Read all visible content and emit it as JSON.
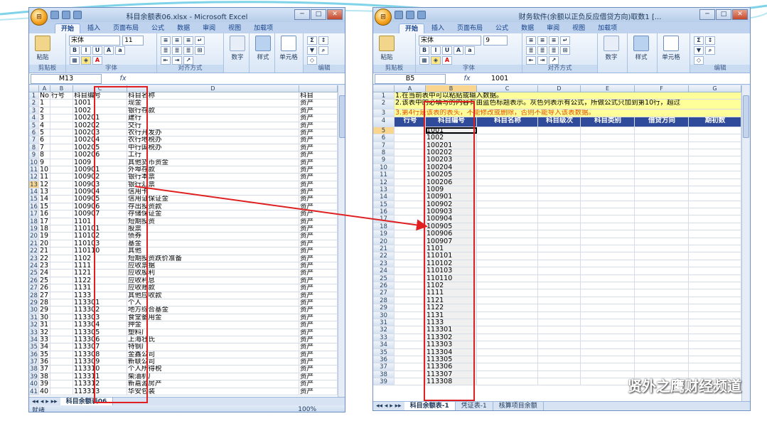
{
  "colors": {
    "accent": "#e02020",
    "header_blue": "#2f4b9a",
    "note_yellow": "#ffff99",
    "selection": "#f9d58e"
  },
  "left": {
    "title": "科目余额表06.xlsx - Microsoft Excel",
    "tabs": [
      "开始",
      "插入",
      "页面布局",
      "公式",
      "数据",
      "审阅",
      "视图",
      "加载项"
    ],
    "ribbon": {
      "paste": "粘贴",
      "font_name": "宋体",
      "font_size": "11",
      "number": "%",
      "number_label": "数字",
      "style_label": "样式",
      "cells_label": "单元格",
      "groups": [
        "剪贴板",
        "字体",
        "对齐方式",
        "编辑"
      ]
    },
    "namebox": "M13",
    "fx": "fx",
    "formula": "",
    "col_headers": [
      "A",
      "B",
      "C",
      "D"
    ],
    "header_row": {
      "a": "No",
      "b": "行号",
      "c": "科目编号",
      "d": "科目名称",
      "e": "科目"
    },
    "rows": [
      [
        "1",
        "1001",
        "现金"
      ],
      [
        "2",
        "1002",
        "银行存款"
      ],
      [
        "3",
        "100201",
        "建行"
      ],
      [
        "4",
        "100202",
        "交行"
      ],
      [
        "5",
        "100203",
        "农行开发办"
      ],
      [
        "6",
        "100204",
        "农行地税办"
      ],
      [
        "7",
        "100205",
        "中行国税办"
      ],
      [
        "8",
        "100206",
        "工行"
      ],
      [
        "9",
        "1009",
        "其他货币资金"
      ],
      [
        "10",
        "100901",
        "外埠存款"
      ],
      [
        "11",
        "100902",
        "银行本票"
      ],
      [
        "12",
        "100903",
        "银行汇票"
      ],
      [
        "13",
        "100904",
        "信用卡"
      ],
      [
        "14",
        "100905",
        "信用证保证金"
      ],
      [
        "15",
        "100906",
        "存出投资款"
      ],
      [
        "16",
        "100907",
        "存储保证金"
      ],
      [
        "17",
        "1101",
        "短期投资"
      ],
      [
        "18",
        "110101",
        "股票"
      ],
      [
        "19",
        "110102",
        "债券"
      ],
      [
        "20",
        "110103",
        "基金"
      ],
      [
        "21",
        "110110",
        "其他"
      ],
      [
        "22",
        "1102",
        "短期投资跌价准备"
      ],
      [
        "23",
        "1111",
        "应收票据"
      ],
      [
        "24",
        "1121",
        "应收股利"
      ],
      [
        "25",
        "1122",
        "应收利息"
      ],
      [
        "26",
        "1131",
        "应收账款"
      ],
      [
        "27",
        "1133",
        "其他应收款"
      ],
      [
        "28",
        "113301",
        "个人"
      ],
      [
        "29",
        "113302",
        "地方综合基金"
      ],
      [
        "30",
        "113303",
        "食堂备用金"
      ],
      [
        "31",
        "113304",
        "押金"
      ],
      [
        "32",
        "113305",
        "塑料厂"
      ],
      [
        "33",
        "113306",
        "上海壮氏"
      ],
      [
        "34",
        "113307",
        "特钢厂"
      ],
      [
        "35",
        "113308",
        "金鑫公司"
      ],
      [
        "36",
        "113309",
        "新联公司"
      ],
      [
        "37",
        "113310",
        "个人所得税"
      ],
      [
        "38",
        "113311",
        "柴油机厂"
      ],
      [
        "39",
        "113312",
        "新嘉源房产"
      ],
      [
        "40",
        "113313",
        "华安包装"
      ]
    ],
    "type_word": "资产",
    "sheet_tab": "科目余额表06",
    "status": "就绪",
    "zoom": "100%"
  },
  "right": {
    "title": "财务软件(余额以正负反应借贷方向)取数1 [...",
    "tabs": [
      "开始",
      "插入",
      "页面布局",
      "公式",
      "数据",
      "审阅",
      "视图",
      "加载项"
    ],
    "ribbon": {
      "paste": "粘贴",
      "font_name": "宋体",
      "font_size": "9",
      "number": "%",
      "number_label": "数字",
      "style_label": "样式",
      "cells_label": "单元格",
      "groups": [
        "剪贴板",
        "字体",
        "对齐方式",
        "编辑"
      ]
    },
    "namebox": "B5",
    "fx": "fx",
    "formula": "1001",
    "col_headers": [
      "A",
      "B",
      "C",
      "D",
      "E",
      "F",
      "G"
    ],
    "notes": [
      "1.在当前表中可以粘贴或输入数据。",
      "2.该表中的必填写的内容有由蓝色标题表示。灰色列表示有公式，所做公式只加到第10行，超过",
      "3.第4行是该表的表头，不能修改或删除，否则不能导入该表数据。"
    ],
    "headers": [
      "行号",
      "科目编号",
      "科目名称",
      "科目级次",
      "科目类别",
      "借贷方向",
      "期初数"
    ],
    "codes": [
      "1001",
      "1002",
      "100201",
      "100202",
      "100203",
      "100204",
      "100205",
      "100206",
      "1009",
      "100901",
      "100902",
      "100903",
      "100904",
      "100905",
      "100906",
      "100907",
      "1101",
      "110101",
      "110102",
      "110103",
      "110110",
      "1102",
      "1111",
      "1121",
      "1122",
      "1131",
      "1133",
      "113301",
      "113302",
      "113303",
      "113304",
      "113305",
      "113306",
      "113307",
      "113308"
    ],
    "sheet_tabs": [
      "科目余额表-1",
      "凭证表-1",
      "核算项目余额"
    ]
  },
  "watermark": "贤外之鹰财经频道"
}
